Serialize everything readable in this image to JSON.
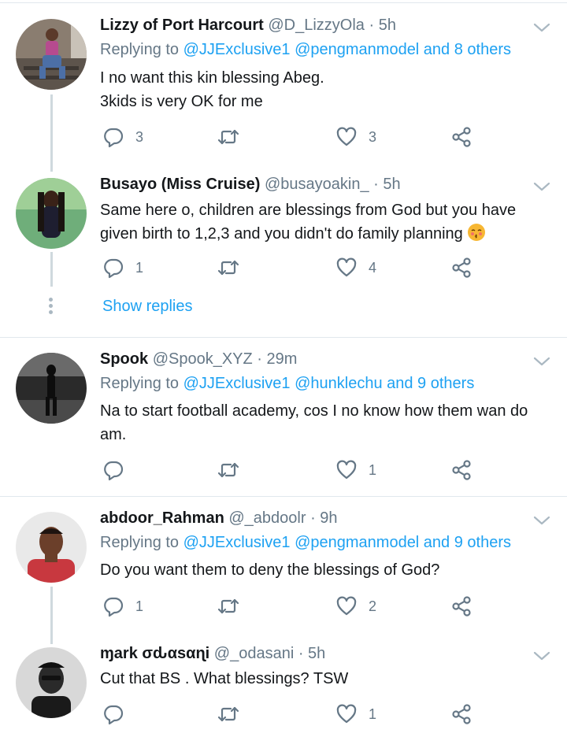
{
  "tweets": [
    {
      "name": "Lizzy of Port Harcourt",
      "handle": "@D_LizzyOla",
      "time": "· 5h",
      "replying_prefix": "Replying to ",
      "replying_to": "@JJExclusive1 @pengmanmodel and 8 others",
      "lines": [
        "I no want this kin blessing Abeg.",
        "3kids is very OK for me"
      ],
      "replies": "3",
      "retweets": "",
      "likes": "3"
    },
    {
      "name": "Busayo (Miss Cruise)",
      "handle": "@busayoakin_",
      "time": "· 5h",
      "lines": [
        "Same here o, children are blessings from God but you have",
        "given birth to 1,2,3 and you didn't do family planning"
      ],
      "replies": "1",
      "retweets": "",
      "likes": "4"
    },
    {
      "name": "Spook",
      "handle": "@Spook_XYZ",
      "time": "· 29m",
      "replying_prefix": "Replying to ",
      "replying_to": "@JJExclusive1 @hunklechu and 9 others",
      "lines": [
        "Na to start football academy, cos I no know how them wan do",
        "am."
      ],
      "replies": "",
      "retweets": "",
      "likes": "1"
    },
    {
      "name": "abdoor_Rahman",
      "handle": "@_abdoolr",
      "time": "· 9h",
      "replying_prefix": "Replying to ",
      "replying_to": "@JJExclusive1 @pengmanmodel and 9 others",
      "lines": [
        "Do you want them to deny the blessings of God?"
      ],
      "replies": "1",
      "retweets": "",
      "likes": "2"
    },
    {
      "name": "ɱark σԃαsαɳi",
      "handle": "@_odasani",
      "time": "· 5h",
      "lines": [
        "Cut that BS . What blessings? TSW"
      ],
      "replies": "",
      "retweets": "",
      "likes": "1"
    }
  ],
  "show_replies": "Show replies",
  "colors": {
    "accent": "#1da1f2",
    "meta": "#657786",
    "divider": "#e1e8ed"
  },
  "icons": [
    "reply-icon",
    "retweet-icon",
    "like-icon",
    "share-icon",
    "chevron-down-icon"
  ]
}
